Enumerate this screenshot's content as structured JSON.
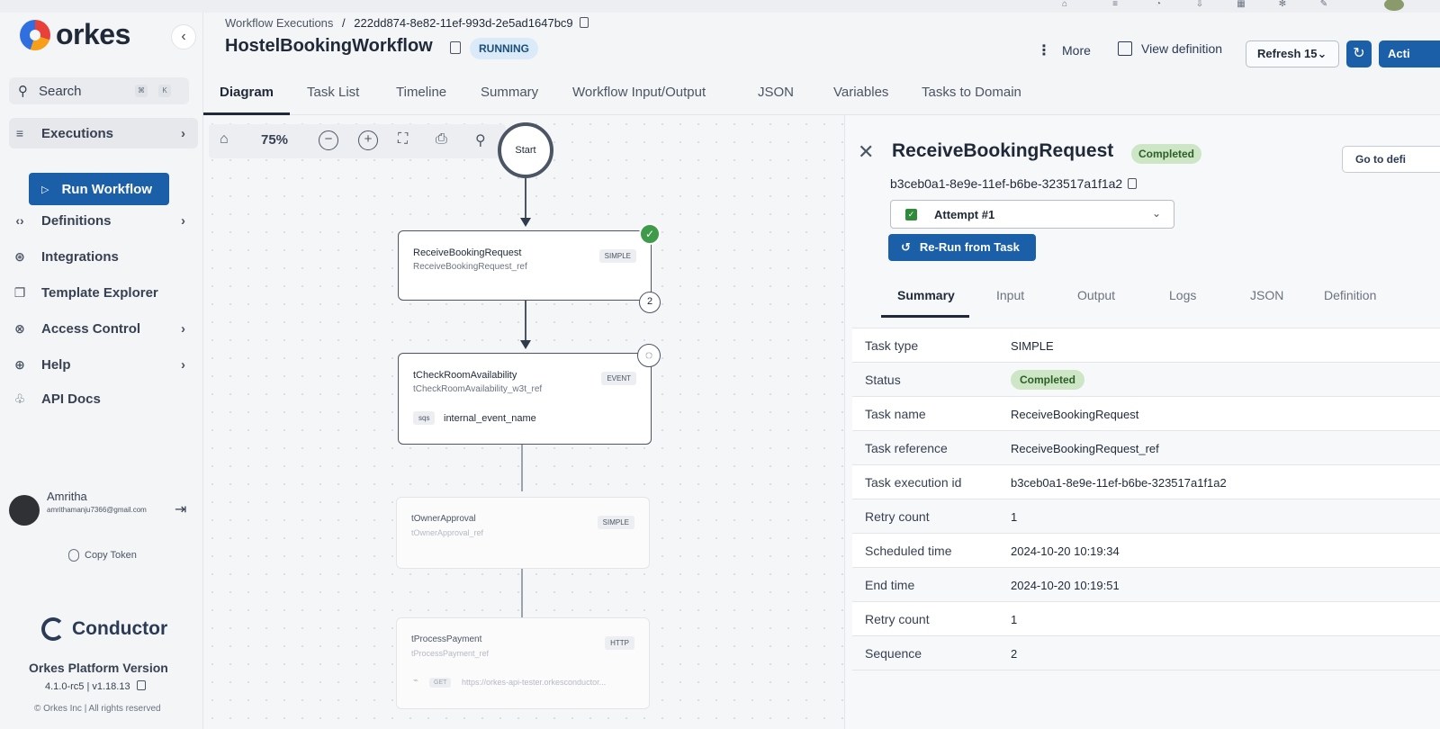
{
  "brand": {
    "name": "orkes"
  },
  "sidebar": {
    "search": {
      "label": "Search",
      "kbd1": "⌘",
      "kbd2": "K"
    },
    "run_workflow": "Run Workflow",
    "items": [
      {
        "label": "Executions",
        "icon": "list-icon"
      },
      {
        "label": "Definitions",
        "icon": "code-icon"
      },
      {
        "label": "Integrations",
        "icon": "integrations-icon"
      },
      {
        "label": "Template Explorer",
        "icon": "template-icon"
      },
      {
        "label": "Access Control",
        "icon": "lock-icon"
      },
      {
        "label": "Help",
        "icon": "help-icon"
      },
      {
        "label": "API Docs",
        "icon": "api-icon"
      }
    ],
    "user": {
      "name": "Amritha",
      "email": "amrithamanju7366@gmail.com"
    },
    "copy_token": "Copy Token",
    "conductor": "Conductor",
    "version_title": "Orkes Platform Version",
    "version": "4.1.0-rc5 | v1.18.13",
    "copyright": "© Orkes Inc | All rights reserved"
  },
  "header": {
    "breadcrumb_root": "Workflow Executions",
    "breadcrumb_sep": "/",
    "execution_id": "222dd874-8e82-11ef-993d-2e5ad1647bc9",
    "title": "HostelBookingWorkflow",
    "status": "RUNNING",
    "more": "More",
    "view_definition": "View definition",
    "refresh": "Refresh 15",
    "actions": "Acti"
  },
  "main_tabs": [
    "Diagram",
    "Task List",
    "Timeline",
    "Summary",
    "Workflow Input/Output",
    "JSON",
    "Variables",
    "Tasks to Domain"
  ],
  "diagram": {
    "zoom": "75%",
    "start_label": "Start",
    "nodes": [
      {
        "name": "ReceiveBookingRequest",
        "ref": "ReceiveBookingRequest_ref",
        "type": "SIMPLE",
        "badge": "2"
      },
      {
        "name": "tCheckRoomAvailability",
        "ref": "tCheckRoomAvailability_w3t_ref",
        "type": "EVENT",
        "sink_type": "sqs",
        "event": "internal_event_name"
      },
      {
        "name": "tOwnerApproval",
        "ref": "tOwnerApproval_ref",
        "type": "SIMPLE"
      },
      {
        "name": "tProcessPayment",
        "ref": "tProcessPayment_ref",
        "type": "HTTP",
        "method": "GET",
        "url": "https://orkes-api-tester.orkesconductor..."
      }
    ]
  },
  "panel": {
    "title": "ReceiveBookingRequest",
    "status": "Completed",
    "go_to": "Go to defi",
    "task_id": "b3ceb0a1-8e9e-11ef-b6be-323517a1f1a2",
    "attempt": "Attempt #1",
    "rerun": "Re-Run from Task",
    "tabs": [
      "Summary",
      "Input",
      "Output",
      "Logs",
      "JSON",
      "Definition"
    ],
    "summary": [
      {
        "key": "Task type",
        "value": "SIMPLE"
      },
      {
        "key": "Status",
        "value": "Completed"
      },
      {
        "key": "Task name",
        "value": "ReceiveBookingRequest"
      },
      {
        "key": "Task reference",
        "value": "ReceiveBookingRequest_ref"
      },
      {
        "key": "Task execution id",
        "value": "b3ceb0a1-8e9e-11ef-b6be-323517a1f1a2"
      },
      {
        "key": "Retry count",
        "value": "1"
      },
      {
        "key": "Scheduled time",
        "value": "2024-10-20 10:19:34"
      },
      {
        "key": "End time",
        "value": "2024-10-20 10:19:51"
      },
      {
        "key": "Retry count",
        "value": "1"
      },
      {
        "key": "Sequence",
        "value": "2"
      }
    ]
  },
  "colors": {
    "primary": "#1b5fa8",
    "success": "#3f9b4a",
    "running_bg": "#dbeaf8"
  }
}
